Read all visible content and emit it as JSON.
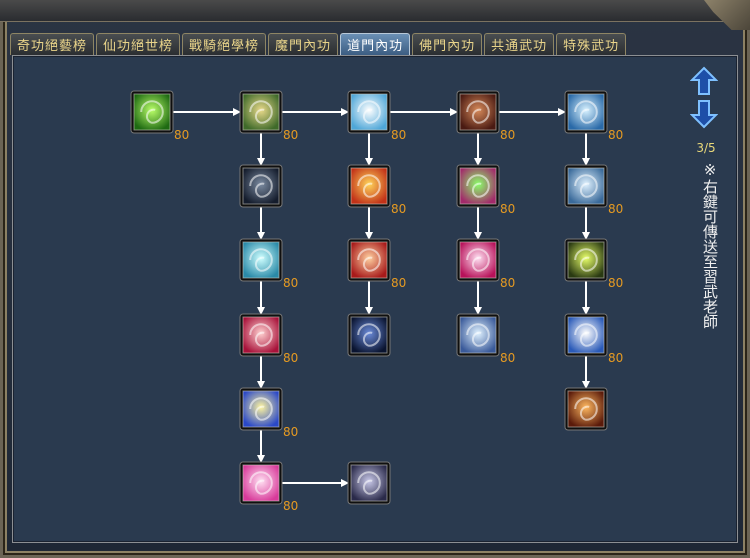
{
  "tabs": [
    {
      "label": "奇功絕藝榜",
      "active": false
    },
    {
      "label": "仙功絕世榜",
      "active": false
    },
    {
      "label": "戰騎絕學榜",
      "active": false
    },
    {
      "label": "魔門內功",
      "active": false
    },
    {
      "label": "道門內功",
      "active": true
    },
    {
      "label": "佛門內功",
      "active": false
    },
    {
      "label": "共通武功",
      "active": false
    },
    {
      "label": "特殊武功",
      "active": false
    }
  ],
  "pager": {
    "page": "3/5"
  },
  "hint": "※右鍵可傳送至習武老師",
  "colors": {
    "accent_gold": "#e8d87a",
    "level_text": "#e59a22",
    "arrow_blue": "#3f7cd8",
    "panel_bg": "#2a3a4f"
  },
  "skills": [
    {
      "id": "s1",
      "icon": "green-comet-icon",
      "level": "80",
      "c1": "#baff6a",
      "c2": "#1e6a12"
    },
    {
      "id": "s2",
      "icon": "landscape-icon",
      "level": "80",
      "c1": "#e8d98a",
      "c2": "#3f6a2a"
    },
    {
      "id": "s3",
      "icon": "ice-crystal-icon",
      "level": "80",
      "c1": "#ffffff",
      "c2": "#4fa7d8"
    },
    {
      "id": "s4",
      "icon": "warrior-body-icon",
      "level": "80",
      "c1": "#d68a5a",
      "c2": "#4a1a12"
    },
    {
      "id": "s5",
      "icon": "blue-swirl-icon",
      "level": "80",
      "c1": "#d8f2ff",
      "c2": "#2a6aa8"
    },
    {
      "id": "s6",
      "icon": "moon-night-icon",
      "level": "",
      "c1": "#7a8aa0",
      "c2": "#141c2c"
    },
    {
      "id": "s7",
      "icon": "fire-orb-icon",
      "level": "80",
      "c1": "#ffd45a",
      "c2": "#c23218"
    },
    {
      "id": "s8",
      "icon": "rainbow-burst-icon",
      "level": "80",
      "c1": "#8aff6a",
      "c2": "#a22a6a"
    },
    {
      "id": "s9",
      "icon": "wind-spiral-icon",
      "level": "80",
      "c1": "#e0f2ff",
      "c2": "#3a6a9a"
    },
    {
      "id": "s10",
      "icon": "water-vortex-icon",
      "level": "80",
      "c1": "#cfffff",
      "c2": "#2a8aa8"
    },
    {
      "id": "s11",
      "icon": "red-spiral-icon",
      "level": "80",
      "c1": "#ffd0a0",
      "c2": "#a81a1a"
    },
    {
      "id": "s12",
      "icon": "pink-ring-icon",
      "level": "80",
      "c1": "#ffe0f2",
      "c2": "#b8125a"
    },
    {
      "id": "s13",
      "icon": "green-spiral-icon",
      "level": "80",
      "c1": "#e8ff6a",
      "c2": "#2a3a12"
    },
    {
      "id": "s14",
      "icon": "crimson-drop-icon",
      "level": "80",
      "c1": "#ffd0d0",
      "c2": "#a8123a"
    },
    {
      "id": "s15",
      "icon": "star-field-icon",
      "level": "",
      "c1": "#6a8ad8",
      "c2": "#0a1430"
    },
    {
      "id": "s16",
      "icon": "water-wave-icon",
      "level": "80",
      "c1": "#e0f2ff",
      "c2": "#3a5a9a"
    },
    {
      "id": "s17",
      "icon": "lightning-burst-icon",
      "level": "80",
      "c1": "#ffffff",
      "c2": "#2a5ab8"
    },
    {
      "id": "s18",
      "icon": "golden-sun-icon",
      "level": "80",
      "c1": "#fff6a0",
      "c2": "#2a48c8"
    },
    {
      "id": "s19",
      "icon": "ember-glow-icon",
      "level": "",
      "c1": "#ffb860",
      "c2": "#5a1a0a"
    },
    {
      "id": "s20",
      "icon": "pink-vortex-icon",
      "level": "80",
      "c1": "#ffe0f2",
      "c2": "#d83a9a"
    },
    {
      "id": "s21",
      "icon": "crescent-moon-icon",
      "level": "",
      "c1": "#c8c8e8",
      "c2": "#2a2a4a"
    }
  ]
}
